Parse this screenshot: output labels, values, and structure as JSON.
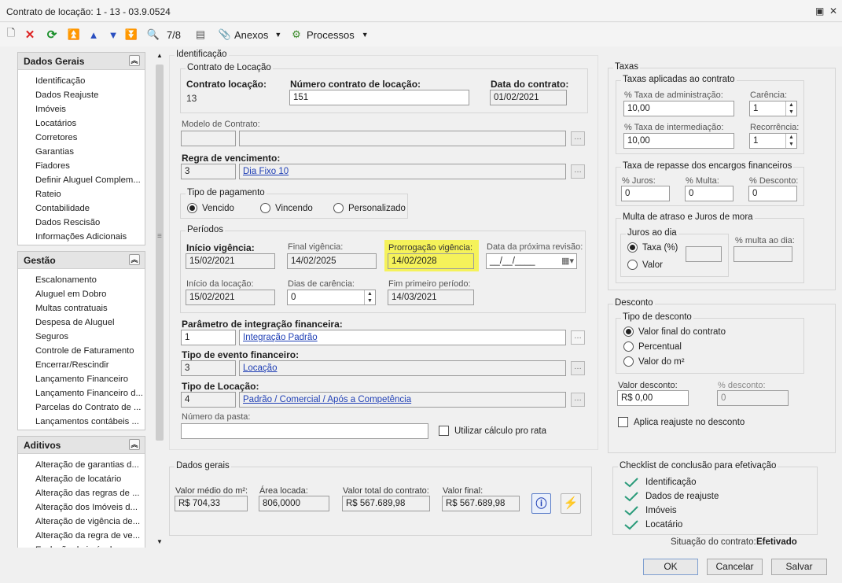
{
  "window": {
    "title": "Contrato de locação: 1 - 13 - 03.9.0524"
  },
  "toolbar": {
    "record_position": "7/8",
    "anexos": "Anexos",
    "processos": "Processos"
  },
  "sidebar": {
    "dados_gerais": {
      "title": "Dados Gerais",
      "items": [
        "Identificação",
        "Dados Reajuste",
        "Imóveis",
        "Locatários",
        "Corretores",
        "Garantias",
        "Fiadores",
        "Definir Aluguel Complem...",
        "Rateio",
        "Contabilidade",
        "Dados Rescisão",
        "Informações Adicionais"
      ]
    },
    "gestao": {
      "title": "Gestão",
      "items": [
        "Escalonamento",
        "Aluguel em Dobro",
        "Multas contratuais",
        "Despesa de Aluguel",
        "Seguros",
        "Controle de Faturamento",
        "Encerrar/Rescindir",
        "Lançamento Financeiro",
        "Lançamento Financeiro d...",
        "Parcelas do Contrato de ...",
        "Lançamentos contábeis ..."
      ]
    },
    "aditivos": {
      "title": "Aditivos",
      "items": [
        "Alteração de garantias d...",
        "Alteração de locatário",
        "Alteração das regras de ...",
        "Alteração dos Imóveis d...",
        "Alteração de vigência de...",
        "Alteração da regra de ve...",
        "Exclusão de imóvel"
      ]
    }
  },
  "identificacao": {
    "title": "Identificação",
    "contrato": {
      "group": "Contrato de Locação",
      "contrato_label": "Contrato locação:",
      "contrato_value": "13",
      "numero_label": "Número contrato de locação:",
      "numero_value": "151",
      "data_label": "Data do contrato:",
      "data_value": "01/02/2021"
    },
    "modelo": {
      "label": "Modelo de Contrato:",
      "code": "",
      "desc": ""
    },
    "regra": {
      "label": "Regra de vencimento:",
      "code": "3",
      "desc": "Dia Fixo 10"
    },
    "pagamento": {
      "group": "Tipo de pagamento",
      "options": [
        "Vencido",
        "Vincendo",
        "Personalizado"
      ],
      "selected": "Vencido"
    },
    "periodos": {
      "group": "Períodos",
      "inicio_vig_label": "Início vigência:",
      "inicio_vig": "15/02/2021",
      "final_vig_label": "Final vigência:",
      "final_vig": "14/02/2025",
      "prorrog_label": "Prorrogação vigência:",
      "prorrog": "14/02/2028",
      "revisao_label": "Data da próxima revisão:",
      "revisao": "__/__/____",
      "inicio_loc_label": "Início da locação:",
      "inicio_loc": "15/02/2021",
      "carencia_label": "Dias de carência:",
      "carencia": "0",
      "fim_label": "Fim primeiro período:",
      "fim": "14/03/2021"
    },
    "param": {
      "label": "Parâmetro de integração financeira:",
      "code": "1",
      "desc": "Integração Padrão"
    },
    "evento": {
      "label": "Tipo de evento financeiro:",
      "code": "3",
      "desc": "Locação"
    },
    "locacao": {
      "label": "Tipo de Locação:",
      "code": "4",
      "desc": "Padrão / Comercial / Após a Competência"
    },
    "pasta": {
      "label": "Número da pasta:",
      "value": "",
      "prorata": "Utilizar cálculo pro rata"
    }
  },
  "taxas": {
    "title": "Taxas",
    "aplicadas": {
      "group": "Taxas aplicadas ao contrato",
      "adm_label": "% Taxa de administração:",
      "adm": "10,00",
      "carencia_label": "Carência:",
      "carencia": "1",
      "inter_label": "% Taxa de intermediação:",
      "inter": "10,00",
      "recorrencia_label": "Recorrência:",
      "recorrencia": "1"
    },
    "repasse": {
      "group": "Taxa de repasse dos encargos financeiros",
      "juros_label": "% Juros:",
      "juros": "0",
      "multa_label": "% Multa:",
      "multa": "0",
      "desconto_label": "% Desconto:",
      "desconto": "0"
    },
    "multa": {
      "group": "Multa de atraso e Juros de mora",
      "juros_group": "Juros ao dia",
      "options": [
        "Taxa (%)",
        "Valor"
      ],
      "selected": "Taxa (%)",
      "multa_label": "% multa ao dia:"
    }
  },
  "desconto": {
    "title": "Desconto",
    "tipo_group": "Tipo de desconto",
    "options": [
      "Valor final do contrato",
      "Percentual",
      "Valor do m²"
    ],
    "selected": "Valor final do contrato",
    "valor_label": "Valor desconto:",
    "valor": "R$ 0,00",
    "perc_label": "% desconto:",
    "perc": "0",
    "reajuste": "Aplica reajuste no desconto"
  },
  "dados_gerais": {
    "title": "Dados gerais",
    "medio_label": "Valor médio do m²:",
    "medio": "R$ 704,33",
    "area_label": "Área locada:",
    "area": "806,0000",
    "total_label": "Valor total do contrato:",
    "total": "R$ 567.689,98",
    "final_label": "Valor final:",
    "final": "R$ 567.689,98"
  },
  "checklist": {
    "title": "Checklist de conclusão para efetivação",
    "items": [
      "Identificação",
      "Dados de reajuste",
      "Imóveis",
      "Locatário"
    ],
    "situacao_label": "Situação do contrato:",
    "situacao": "Efetivado"
  },
  "buttons": {
    "ok": "OK",
    "cancelar": "Cancelar",
    "salvar": "Salvar"
  }
}
